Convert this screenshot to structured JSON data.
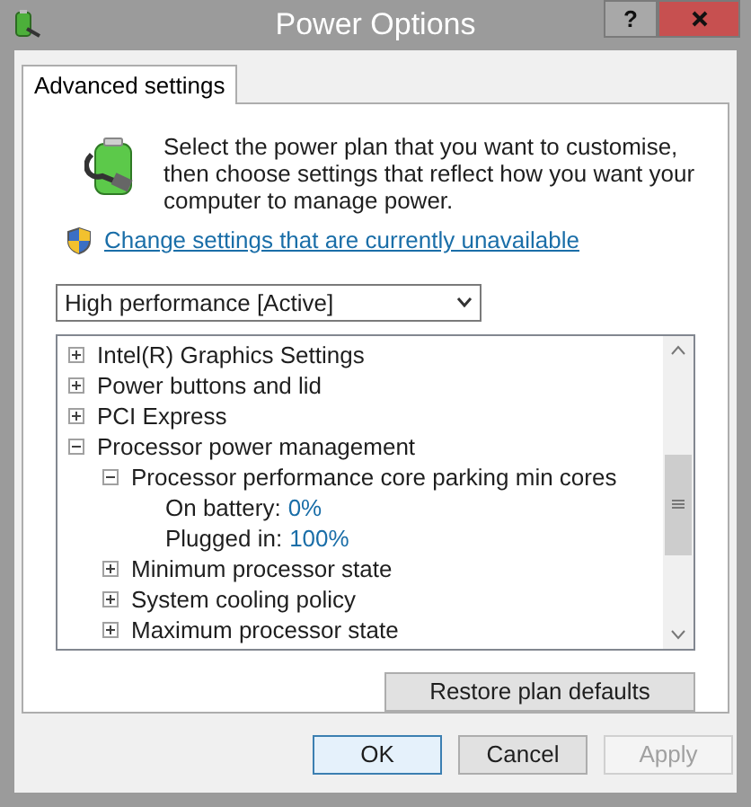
{
  "window": {
    "title": "Power Options",
    "help_button": "?"
  },
  "tabs": [
    {
      "label": "Advanced settings",
      "selected": true
    }
  ],
  "description": "Select the power plan that you want to customise, then choose settings that reflect how you want your computer to manage power.",
  "change_link": "Change settings that are currently unavailable",
  "plan_dropdown": {
    "value": "High performance [Active]"
  },
  "tree": [
    {
      "kind": "group",
      "label": "Intel(R) Graphics Settings",
      "expanded": false
    },
    {
      "kind": "group",
      "label": "Power buttons and lid",
      "expanded": false
    },
    {
      "kind": "group",
      "label": "PCI Express",
      "expanded": false
    },
    {
      "kind": "group",
      "label": "Processor power management",
      "expanded": true,
      "children": [
        {
          "kind": "group",
          "label": "Processor performance core parking min cores",
          "expanded": true,
          "children": [
            {
              "kind": "setting",
              "label": "On battery:",
              "value": "0%"
            },
            {
              "kind": "setting",
              "label": "Plugged in:",
              "value": "100%"
            }
          ]
        },
        {
          "kind": "group",
          "label": "Minimum processor state",
          "expanded": false
        },
        {
          "kind": "group",
          "label": "System cooling policy",
          "expanded": false
        },
        {
          "kind": "group",
          "label": "Maximum processor state",
          "expanded": false
        }
      ]
    }
  ],
  "restore_button": "Restore plan defaults",
  "buttons": [
    {
      "label": "OK",
      "default": true,
      "disabled": false
    },
    {
      "label": "Cancel",
      "default": false,
      "disabled": false
    },
    {
      "label": "Apply",
      "default": false,
      "disabled": true
    }
  ]
}
